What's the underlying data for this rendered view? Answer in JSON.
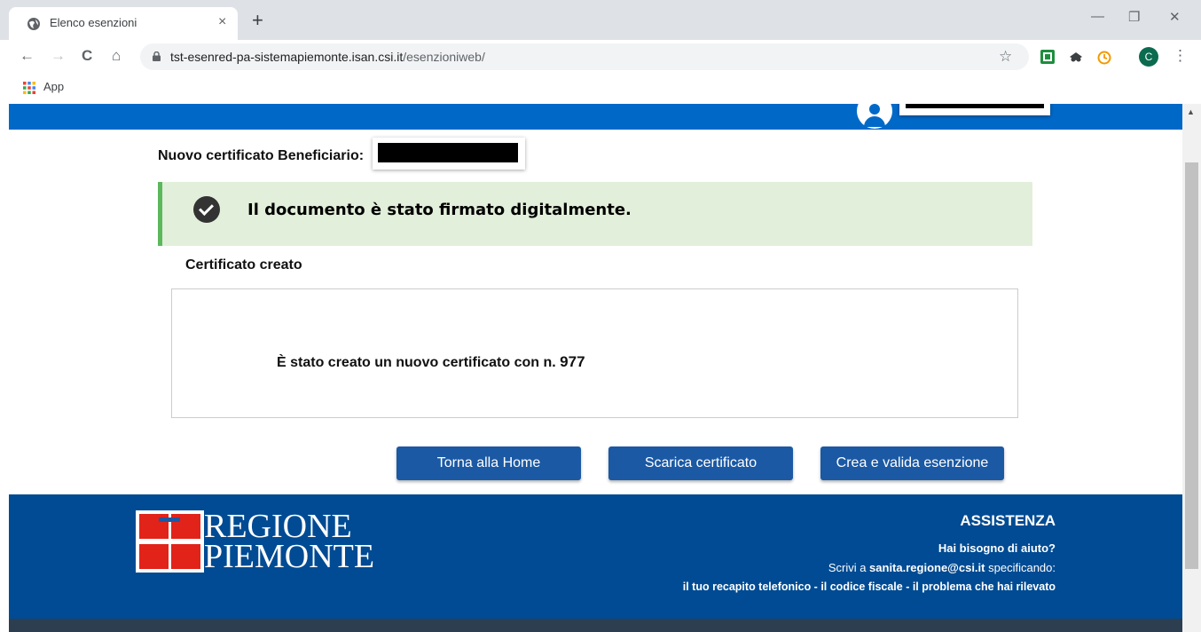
{
  "browser": {
    "tab_title": "Elenco esenzioni",
    "tab_close": "×",
    "new_tab": "+",
    "url_host": "tst-esenred-pa-sistemapiemonte.isan.csi.it",
    "url_path": "/esenzioniweb/",
    "profile_initial": "C",
    "bookmark_apps": "App",
    "window_controls": {
      "minimize": "—",
      "restore": "❐",
      "close": "✕"
    },
    "nav": {
      "back": "←",
      "forward": "→",
      "reload": "C",
      "home": "⌂",
      "star": "☆",
      "menu": "⋮"
    }
  },
  "page": {
    "new_certificate_label": "Nuovo certificato Beneficiario:",
    "alert_message": "Il documento è stato firmato digitalmente.",
    "section_title": "Certificato creato",
    "result_text": "È stato creato un nuovo certificato con n.",
    "certificate_number": "977",
    "buttons": {
      "home": "Torna alla Home",
      "download": "Scarica certificato",
      "create": "Crea e valida esenzione"
    }
  },
  "footer": {
    "logo_line1": "REGIONE",
    "logo_line2": "PIEMONTE",
    "assist_title": "ASSISTENZA",
    "assist_question": "Hai bisogno di aiuto?",
    "assist_write_prefix": "Scrivi a ",
    "assist_email": "sanita.regione@csi.it",
    "assist_write_suffix": " specificando:",
    "assist_info": "il tuo recapito telefonico - il codice fiscale - il problema che hai rilevato"
  },
  "colors": {
    "header_blue": "#0069c8",
    "footer_blue": "#004b93",
    "button_blue": "#1b59a4",
    "alert_green_bg": "#e2efda",
    "alert_green_border": "#5cb85c",
    "logo_red": "#e2231a"
  }
}
